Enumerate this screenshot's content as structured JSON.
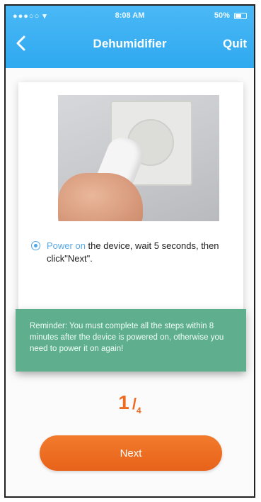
{
  "status_bar": {
    "carrier": "●●●○○ ▾",
    "time": "8:08 AM",
    "battery": "50%"
  },
  "nav": {
    "title": "Dehumidifier",
    "quit_label": "Quit"
  },
  "instruction": {
    "highlight": "Power on",
    "rest": " the device, wait 5 seconds, then click\"Next\"."
  },
  "reminder": {
    "text": "Reminder: You must complete all the steps within 8 minutes after the device is powered on, otherwise you need to power it on again!"
  },
  "step": {
    "current": "1",
    "slash": "/",
    "total": "4"
  },
  "next_button": {
    "label": "Next"
  },
  "colors": {
    "header": "#2fa9f0",
    "accent_orange": "#ef6b22",
    "reminder_green": "#5fae8e",
    "highlight_blue": "#58a9e8"
  },
  "icons": {
    "back": "chevron-left-icon",
    "radio": "radio-selected-icon"
  }
}
